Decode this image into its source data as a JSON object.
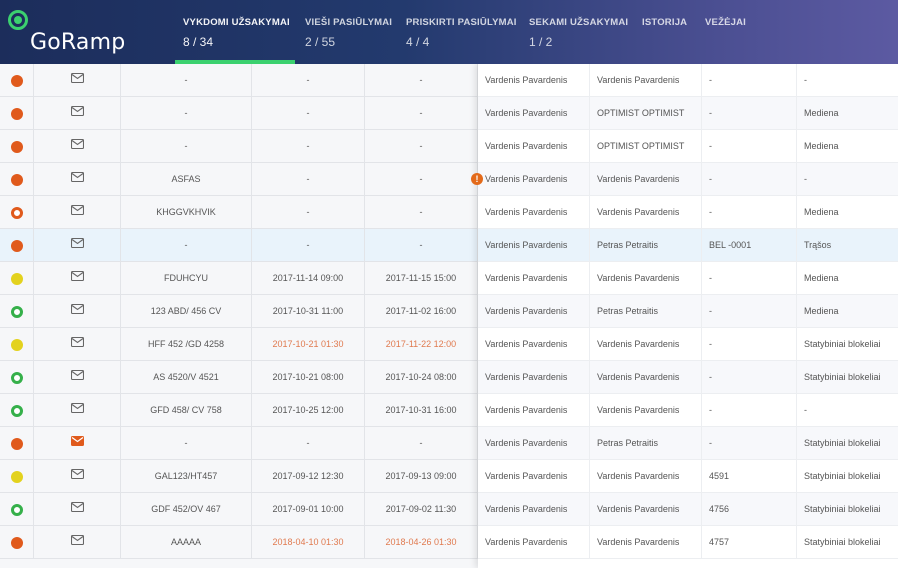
{
  "app": {
    "logo_text": "GoRamp"
  },
  "tabs": [
    {
      "label": "VYKDOMI UŽSAKYMAI",
      "count": "8 / 34",
      "active": true
    },
    {
      "label": "VIEŠI PASIŪLYMAI",
      "count": "2 / 55"
    },
    {
      "label": "PRISKIRTI PASIŪLYMAI",
      "count": "4 / 4"
    },
    {
      "label": "SEKAMI UŽSAKYMAI",
      "count": "1 / 2"
    },
    {
      "label": "ISTORIJA",
      "count": ""
    },
    {
      "label": "VEŽĖJAI",
      "count": ""
    }
  ],
  "colors": {
    "accent_green": "#3bd16f",
    "status_red": "#e05a1c",
    "status_yellow": "#e3d21e",
    "status_green": "#35b04a",
    "late_text": "#e07a4f"
  },
  "rows": [
    {
      "status": "red",
      "icon": "envelope-icon",
      "ref": "-",
      "load": "-",
      "unload": "-",
      "name1": "Vardenis Pavardenis",
      "name2": "Vardenis Pavardenis",
      "code": "-",
      "cargo": "-"
    },
    {
      "status": "red",
      "icon": "envelope-icon",
      "ref": "-",
      "load": "-",
      "unload": "-",
      "name1": "Vardenis Pavardenis",
      "name2": "OPTIMIST OPTIMIST",
      "code": "-",
      "cargo": "Mediena"
    },
    {
      "status": "red",
      "icon": "envelope-icon",
      "ref": "-",
      "load": "-",
      "unload": "-",
      "name1": "Vardenis Pavardenis",
      "name2": "OPTIMIST OPTIMIST",
      "code": "-",
      "cargo": "Mediena"
    },
    {
      "status": "red",
      "icon": "envelope-icon",
      "ref": "ASFAS",
      "load": "-",
      "unload": "-",
      "warn": "!",
      "name1": "Vardenis Pavardenis",
      "name2": "Vardenis Pavardenis",
      "code": "-",
      "cargo": "-"
    },
    {
      "status": "red-ring",
      "icon": "envelope-icon",
      "ref": "KHGGVKHVIK",
      "load": "-",
      "unload": "-",
      "name1": "Vardenis Pavardenis",
      "name2": "Vardenis Pavardenis",
      "code": "-",
      "cargo": "Mediena"
    },
    {
      "status": "red",
      "icon": "envelope-icon",
      "ref": "-",
      "load": "-",
      "unload": "-",
      "name1": "Vardenis Pavardenis",
      "name2": "Petras Petraitis",
      "code": "BEL -0001",
      "cargo": "Trąšos",
      "highlight": true
    },
    {
      "status": "yellow",
      "icon": "envelope-icon",
      "ref": "FDUHCYU",
      "load": "2017-11-14 09:00",
      "unload": "2017-11-15 15:00",
      "name1": "Vardenis Pavardenis",
      "name2": "Vardenis Pavardenis",
      "code": "-",
      "cargo": "Mediena"
    },
    {
      "status": "green-ring",
      "icon": "envelope-icon",
      "ref": "123 ABD/ 456 CV",
      "load": "2017-10-31 11:00",
      "unload": "2017-11-02 16:00",
      "name1": "Vardenis Pavardenis",
      "name2": "Petras Petraitis",
      "code": "-",
      "cargo": "Mediena"
    },
    {
      "status": "yellow",
      "icon": "envelope-icon",
      "ref": "HFF 452 /GD 4258",
      "load": "2017-10-21 01:30",
      "unload": "2017-11-22 12:00",
      "late": true,
      "name1": "Vardenis Pavardenis",
      "name2": "Vardenis Pavardenis",
      "code": "-",
      "cargo": "Statybiniai blokeliai"
    },
    {
      "status": "green-ring",
      "icon": "envelope-icon",
      "ref": "AS 4520/V 4521",
      "load": "2017-10-21 08:00",
      "unload": "2017-10-24 08:00",
      "name1": "Vardenis Pavardenis",
      "name2": "Vardenis Pavardenis",
      "code": "-",
      "cargo": "Statybiniai blokeliai"
    },
    {
      "status": "green-ring",
      "icon": "envelope-icon",
      "ref": "GFD 458/ CV 758",
      "load": "2017-10-25 12:00",
      "unload": "2017-10-31 16:00",
      "name1": "Vardenis Pavardenis",
      "name2": "Vardenis Pavardenis",
      "code": "-",
      "cargo": "-"
    },
    {
      "status": "red",
      "icon": "envelope-filled-icon",
      "ref": "-",
      "load": "-",
      "unload": "-",
      "name1": "Vardenis Pavardenis",
      "name2": "Petras Petraitis",
      "code": "-",
      "cargo": "Statybiniai blokeliai"
    },
    {
      "status": "yellow",
      "icon": "envelope-icon",
      "ref": "GAL123/HT457",
      "load": "2017-09-12 12:30",
      "unload": "2017-09-13 09:00",
      "name1": "Vardenis Pavardenis",
      "name2": "Vardenis Pavardenis",
      "code": "4591",
      "cargo": "Statybiniai blokeliai"
    },
    {
      "status": "green-ring",
      "icon": "envelope-icon",
      "ref": "GDF 452/OV 467",
      "load": "2017-09-01 10:00",
      "unload": "2017-09-02 11:30",
      "name1": "Vardenis Pavardenis",
      "name2": "Vardenis Pavardenis",
      "code": "4756",
      "cargo": "Statybiniai blokeliai"
    },
    {
      "status": "red",
      "icon": "envelope-icon",
      "ref": "AAAAA",
      "load": "2018-04-10 01:30",
      "unload": "2018-04-26 01:30",
      "late": true,
      "name1": "Vardenis Pavardenis",
      "name2": "Vardenis Pavardenis",
      "code": "4757",
      "cargo": "Statybiniai blokeliai"
    }
  ]
}
